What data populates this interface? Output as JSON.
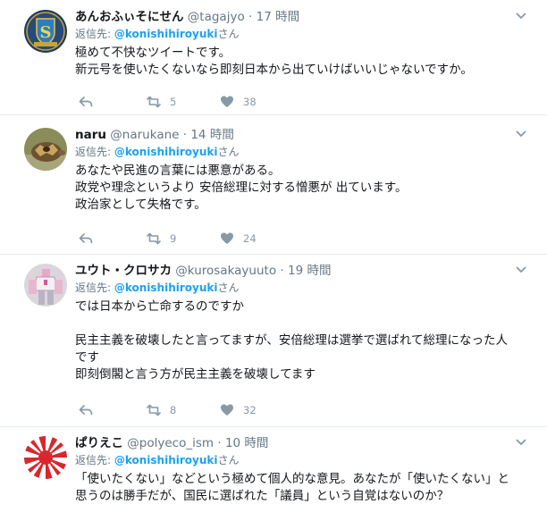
{
  "tweets": [
    {
      "name": "あんおふぃそにせん",
      "handle": "@tagajyo",
      "time": "17 時間",
      "reply_prefix": "返信先: ",
      "reply_mention": "@konishihiroyuki",
      "reply_suffix": "さん",
      "lines": [
        "極めて不快なツイートです。",
        "新元号を使いたくないなら即刻日本から出ていけばいいじゃないですか。"
      ],
      "retweets": "5",
      "likes": "38",
      "avatar": "shield-emblem"
    },
    {
      "name": "naru",
      "handle": "@narukane",
      "time": "14 時間",
      "reply_prefix": "返信先: ",
      "reply_mention": "@konishihiroyuki",
      "reply_suffix": "さん",
      "lines": [
        "あなたや民進の言葉には悪意がある。",
        "政党や理念というより 安倍総理に対する憎悪が 出ています。",
        "政治家として失格です。"
      ],
      "retweets": "9",
      "likes": "24",
      "avatar": "tortoise-photo"
    },
    {
      "name": "ユウト・クロサカ",
      "handle": "@kurosakayuuto",
      "time": "19 時間",
      "reply_prefix": "返信先: ",
      "reply_mention": "@konishihiroyuki",
      "reply_suffix": "さん",
      "lines": [
        "では日本から亡命するのですか",
        "",
        "民主主義を破壊したと言ってますが、安倍総理は選挙で選ばれて総理になった人",
        "です",
        "即刻倒閣と言う方が民主主義を破壊してます"
      ],
      "retweets": "8",
      "likes": "32",
      "avatar": "robot-figure"
    },
    {
      "name": "ぱりえこ",
      "handle": "@polyeco_ism",
      "time": "10 時間",
      "reply_prefix": "返信先: ",
      "reply_mention": "@konishihiroyuki",
      "reply_suffix": "さん",
      "lines": [
        "「使いたくない」などという極めて個人的な意見。あなたが「使いたくない」と",
        "思うのは勝手だが、国民に選ばれた「議員」という自覚はないのか？"
      ],
      "avatar": "rising-sun-flag"
    }
  ],
  "colors": {
    "mention": "#1da1f2",
    "secondary": "#657786",
    "icon": "#8899a6"
  }
}
